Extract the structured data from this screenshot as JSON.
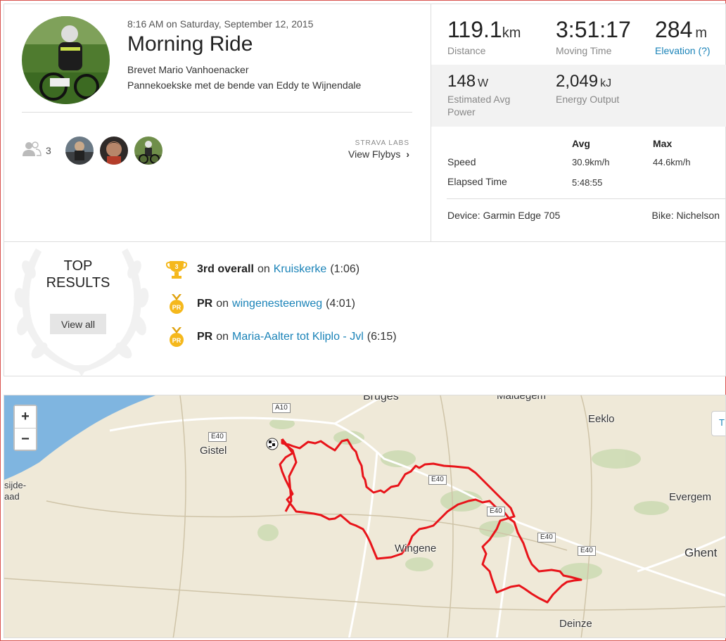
{
  "activity": {
    "timestamp": "8:16 AM on Saturday, September 12, 2015",
    "title": "Morning Ride",
    "description_line1": "Brevet Mario Vanhoenacker",
    "description_line2": "Pannekoekske met de bende van Eddy te Wijnendale"
  },
  "athletes": {
    "count": "3",
    "labs_tag": "STRAVA LABS",
    "flybys_label": "View Flybys",
    "flybys_icon": "chevron-right-icon"
  },
  "stats": {
    "distance": {
      "value": "119.1",
      "unit": "km",
      "label": "Distance"
    },
    "moving_time": {
      "value": "3:51:17",
      "label": "Moving Time"
    },
    "elevation": {
      "value": "284",
      "unit": "m",
      "label": "Elevation (?)"
    },
    "power": {
      "value": "148",
      "unit": "W",
      "label_line1": "Estimated Avg",
      "label_line2": "Power"
    },
    "energy": {
      "value": "2,049",
      "unit": "kJ",
      "label": "Energy Output"
    }
  },
  "summary_table": {
    "headers": {
      "avg": "Avg",
      "max": "Max"
    },
    "rows": [
      {
        "label": "Speed",
        "avg": "30.9km/h",
        "max": "44.6km/h"
      },
      {
        "label": "Elapsed Time",
        "avg": "5:48:55",
        "max": ""
      }
    ],
    "device": "Device: Garmin Edge 705",
    "bike": "Bike: Nichelson"
  },
  "top_results": {
    "title_line1": "TOP",
    "title_line2": "RESULTS",
    "view_all": "View all",
    "items": [
      {
        "medal": "3",
        "rank": "3rd overall",
        "on": "on",
        "segment": "Kruiskerke",
        "time": "(1:06)",
        "icon": "trophy-icon"
      },
      {
        "medal": "PR",
        "rank": "PR",
        "on": "on",
        "segment": "wingenesteenweg",
        "time": "(4:01)",
        "icon": "pr-medal-icon"
      },
      {
        "medal": "PR",
        "rank": "PR",
        "on": "on",
        "segment": "Maria-Aalter tot Kliplo - Jvl",
        "time": "(6:15)",
        "icon": "pr-medal-icon"
      }
    ]
  },
  "map": {
    "zoom_in": "+",
    "zoom_out": "−",
    "corner_text": "T",
    "places": {
      "bruges": "Bruges",
      "maldegem": "Maldegem",
      "eeklo": "Eeklo",
      "gistel": "Gistel",
      "evergem": "Evergem",
      "ghent": "Ghent",
      "wingene": "Wingene",
      "deinze": "Deinze",
      "sijde": "sijde-",
      "aad": "aad"
    },
    "roads": {
      "a10": "A10",
      "e40": "E40",
      "a110": "A10"
    },
    "route_color": "#e8141a",
    "water_color": "#7fb5e0"
  },
  "colors": {
    "link": "#1a83b8",
    "medal": "#f5b81c",
    "frame": "#d9534f"
  }
}
